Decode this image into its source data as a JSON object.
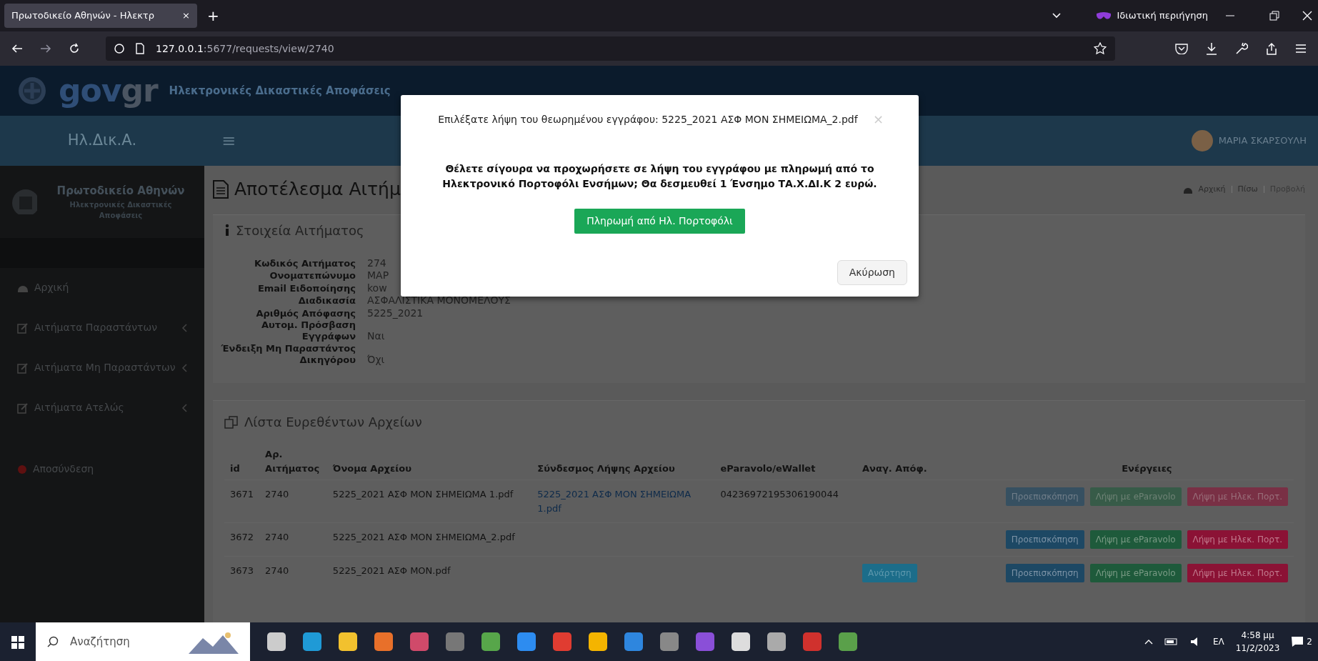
{
  "browser": {
    "tab_title": "Πρωτοδικείο Αθηνών - Ηλεκτρ",
    "tab_close": "×",
    "new_tab": "+",
    "url_host": "127.0.0.1",
    "url_rest": ":5677/requests/view/2740",
    "private_label": "Ιδιωτική περιήγηση"
  },
  "header": {
    "logo": [
      "gov",
      "gr"
    ],
    "title": "Ηλεκτρονικές Δικαστικές Αποφάσεις"
  },
  "navbar": {
    "brand": "Ηλ.Δικ.Α.",
    "menu": "≡",
    "user": "ΜΑΡΙΑ ΣΚΑΡΣΟΥΛΗ"
  },
  "sidebar": {
    "court": "Πρωτοδικείο Αθηνών",
    "subtitle": "Ηλεκτρονικές Δικαστικές Αποφάσεις",
    "items": [
      {
        "label": "Αρχική",
        "kind": "home",
        "expandable": false
      },
      {
        "label": "Αιτήματα Παραστάντων",
        "kind": "edit",
        "expandable": true
      },
      {
        "label": "Αιτήματα Μη Παραστάντων",
        "kind": "edit",
        "expandable": true
      },
      {
        "label": "Αιτήματα Ατελώς",
        "kind": "edit",
        "expandable": true
      },
      {
        "label": "Αποσύνδεση",
        "kind": "logout",
        "expandable": false
      }
    ]
  },
  "page": {
    "title": "Αποτέλεσμα Αιτήμ",
    "breadcrumbs": [
      "Αρχική",
      "Πίσω",
      "Προβολή"
    ],
    "details": {
      "title": "Στοιχεία Αιτήματος",
      "rows": [
        {
          "label": "Κωδικός Αιτήματος",
          "value": "274"
        },
        {
          "label": "Ονοματεπώνυμο",
          "value": "ΜΑΡ"
        },
        {
          "label": "Email Ειδοποίησης",
          "value": "kow"
        },
        {
          "label": "Διαδικασία",
          "value": "ΑΣΦΑΛΙΣΤΙΚΑ ΜΟΝΟΜΕΛΟΥΣ"
        },
        {
          "label": "Αριθμός Απόφασης",
          "value": "5225_2021"
        },
        {
          "label": "Αυτομ. Πρόσβαση Εγγράφων",
          "value": "Ναι"
        },
        {
          "label": "Ένδειξη Μη Παραστάντος Δικηγόρου",
          "value": "Όχι"
        }
      ]
    },
    "files": {
      "title": "Λίστα Ευρεθέντων Αρχείων",
      "columns": [
        "id",
        "Αρ. Αιτήματος",
        "Όνομα Αρχείου",
        "Σύνδεσμος Λήψης Αρχείου",
        "eParavolo/eWallet",
        "Αναγ. Απόφ.",
        "Ενέργειες"
      ],
      "rows": [
        {
          "id": "3671",
          "request": "2740",
          "file": "5225_2021 ΑΣΦ ΜΟΝ ΣΗΜΕΙΩΜΑ 1.pdf",
          "link": "5225_2021 ΑΣΦ ΜΟΝ ΣΗΜΕΙΩΜΑ 1.pdf",
          "eparavolo": "04236972195306190044",
          "actions": [
            {
              "label": "Προεπισκόπηση",
              "kind": "preview",
              "disabled": true
            },
            {
              "label": "Λήψη με eParavolo",
              "kind": "eparavolo",
              "disabled": true
            },
            {
              "label": "Λήψη με Ηλεκ. Πορτ.",
              "kind": "wallet",
              "disabled": true
            }
          ]
        },
        {
          "id": "3672",
          "request": "2740",
          "file": "5225_2021 ΑΣΦ ΜΟΝ ΣΗΜΕΙΩΜΑ_2.pdf",
          "actions": [
            {
              "label": "Προεπισκόπηση",
              "kind": "preview",
              "disabled": false
            },
            {
              "label": "Λήψη με eParavolo",
              "kind": "eparavolo",
              "disabled": false
            },
            {
              "label": "Λήψη με Ηλεκ. Πορτ.",
              "kind": "wallet",
              "disabled": false
            }
          ]
        },
        {
          "id": "3673",
          "request": "2740",
          "file": "5225_2021 ΑΣΦ ΜΟΝ.pdf",
          "decision": "Ανάρτηση",
          "actions": [
            {
              "label": "Προεπισκόπηση",
              "kind": "preview",
              "disabled": false
            },
            {
              "label": "Λήψη με eParavolo",
              "kind": "eparavolo",
              "disabled": false
            },
            {
              "label": "Λήψη με Ηλεκ. Πορτ.",
              "kind": "wallet",
              "disabled": false
            }
          ]
        }
      ]
    }
  },
  "modal": {
    "title": "Επιλέξατε λήψη του θεωρημένου εγγράφου: 5225_2021 ΑΣΦ ΜΟΝ ΣΗΜΕΙΩΜΑ_2.pdf",
    "close": "×",
    "message": "Θέλετε σίγουρα να προχωρήσετε σε λήψη του εγγράφου με πληρωμή από το Ηλεκτρονικό Πορτοφόλι Ενσήμων; Θα δεσμευθεί 1 Ένσημο ΤΑ.Χ.ΔΙ.Κ 2 ευρώ.",
    "confirm": "Πληρωμή από Ηλ. Πορτοφόλι",
    "cancel": "Ακύρωση"
  },
  "taskbar": {
    "search_placeholder": "Αναζήτηση",
    "language": "ΕΛ",
    "time": "4:58 μμ",
    "date": "11/2/2023",
    "notifications": "2"
  }
}
